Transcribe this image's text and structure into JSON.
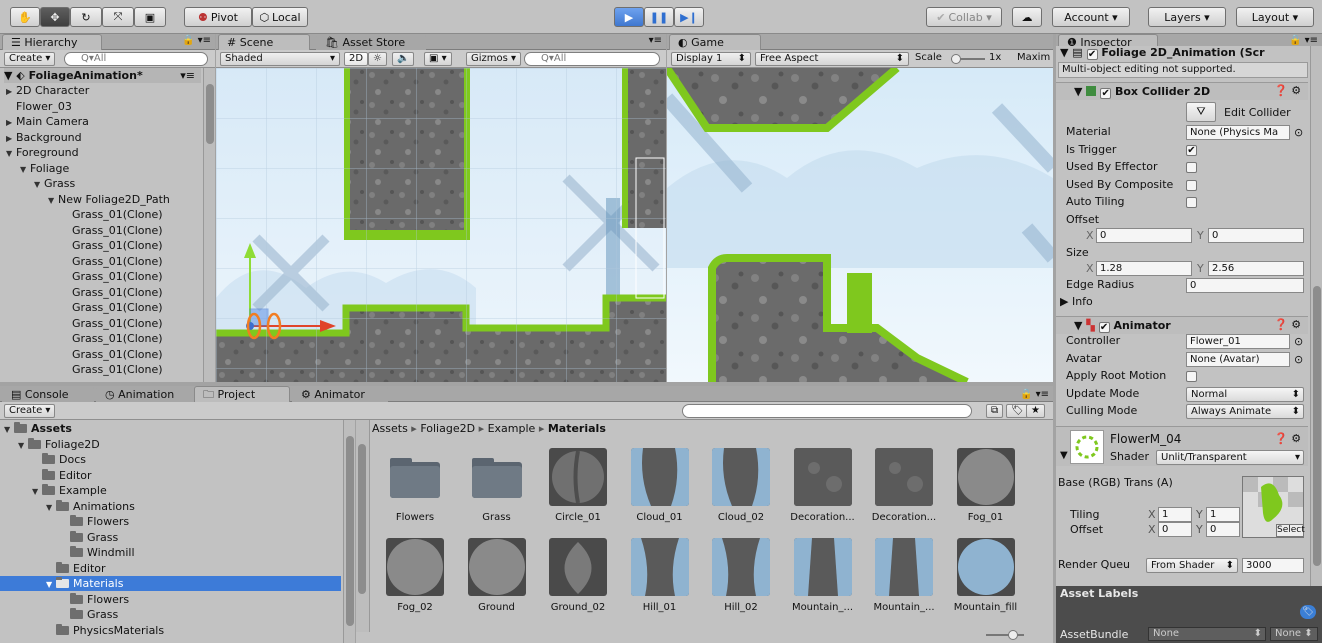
{
  "toolbar": {
    "tools": [
      "hand-icon",
      "move-icon",
      "rotate-icon",
      "scale-icon",
      "rect-icon"
    ],
    "pivot": "Pivot",
    "local": "Local",
    "collab": "Collab ▾",
    "account": "Account",
    "layers": "Layers",
    "layout": "Layout"
  },
  "hierarchy": {
    "tab": "Hierarchy",
    "create": "Create ▾",
    "search_placeholder": "Q▾All",
    "scene": "FoliageAnimation*",
    "items": [
      {
        "label": "2D Character",
        "indent": 1,
        "arrow": "▶"
      },
      {
        "label": "Flower_03",
        "indent": 1,
        "arrow": ""
      },
      {
        "label": "Main Camera",
        "indent": 1,
        "arrow": "▶"
      },
      {
        "label": "Background",
        "indent": 1,
        "arrow": "▶"
      },
      {
        "label": "Foreground",
        "indent": 1,
        "arrow": "▼"
      },
      {
        "label": "Foliage",
        "indent": 2,
        "arrow": "▼"
      },
      {
        "label": "Grass",
        "indent": 3,
        "arrow": "▼"
      },
      {
        "label": "New Foliage2D_Path",
        "indent": 4,
        "arrow": "▼"
      },
      {
        "label": "Grass_01(Clone)",
        "indent": 5,
        "arrow": ""
      },
      {
        "label": "Grass_01(Clone)",
        "indent": 5,
        "arrow": ""
      },
      {
        "label": "Grass_01(Clone)",
        "indent": 5,
        "arrow": ""
      },
      {
        "label": "Grass_01(Clone)",
        "indent": 5,
        "arrow": ""
      },
      {
        "label": "Grass_01(Clone)",
        "indent": 5,
        "arrow": ""
      },
      {
        "label": "Grass_01(Clone)",
        "indent": 5,
        "arrow": ""
      },
      {
        "label": "Grass_01(Clone)",
        "indent": 5,
        "arrow": ""
      },
      {
        "label": "Grass_01(Clone)",
        "indent": 5,
        "arrow": ""
      },
      {
        "label": "Grass_01(Clone)",
        "indent": 5,
        "arrow": ""
      },
      {
        "label": "Grass_01(Clone)",
        "indent": 5,
        "arrow": ""
      },
      {
        "label": "Grass_01(Clone)",
        "indent": 5,
        "arrow": ""
      }
    ]
  },
  "scene": {
    "tab_scene": "Scene",
    "tab_asset_store": "Asset Store",
    "shaded": "Shaded",
    "mode_2d": "2D",
    "gizmos": "Gizmos ▾",
    "search_placeholder": "Q▾All"
  },
  "game": {
    "tab": "Game",
    "display": "Display 1",
    "aspect": "Free Aspect",
    "scale_label": "Scale",
    "scale_value": "1x",
    "maximize": "Maxim"
  },
  "inspector": {
    "tab": "Inspector",
    "top_component": "Foliage 2D_Animation (Scr",
    "multi_edit": "Multi-object editing not supported.",
    "box_collider": {
      "title": "Box Collider 2D",
      "edit_collider": "Edit Collider",
      "rows": [
        {
          "label": "Material",
          "value": "None (Physics Ma"
        },
        {
          "label": "Is Trigger",
          "check": "✔"
        },
        {
          "label": "Used By Effector",
          "check": ""
        },
        {
          "label": "Used By Composite",
          "check": ""
        },
        {
          "label": "Auto Tiling",
          "check": ""
        }
      ],
      "offset_label": "Offset",
      "offset_x": "0",
      "offset_y": "0",
      "size_label": "Size",
      "size_x": "1.28",
      "size_y": "2.56",
      "edge_radius_label": "Edge Radius",
      "edge_radius": "0",
      "info": "Info"
    },
    "animator": {
      "title": "Animator",
      "rows": [
        {
          "label": "Controller",
          "value": "Flower_01"
        },
        {
          "label": "Avatar",
          "value": "None (Avatar)"
        },
        {
          "label": "Apply Root Motion",
          "value": ""
        },
        {
          "label": "Update Mode",
          "value": "Normal"
        },
        {
          "label": "Culling Mode",
          "value": "Always Animate"
        }
      ]
    },
    "material": {
      "name": "FlowerM_04",
      "shader_label": "Shader",
      "shader": "Unlit/Transparent",
      "base_label": "Base (RGB) Trans (A)",
      "tiling_label": "Tiling",
      "offset_label": "Offset",
      "tiling_x": "1",
      "tiling_y": "1",
      "offset_x": "0",
      "offset_y": "0",
      "select": "Select",
      "render_queue_label": "Render Queu",
      "render_queue_mode": "From Shader",
      "render_queue_value": "3000"
    },
    "asset_labels": "Asset Labels",
    "asset_bundle_label": "AssetBundle",
    "asset_bundle_value": "None",
    "asset_bundle_variant": "None"
  },
  "bottom_tabs": {
    "console": "Console",
    "animation": "Animation",
    "project": "Project",
    "animator": "Animator"
  },
  "project": {
    "create": "Create ▾",
    "breadcrumb": [
      "Assets",
      "Foliage2D",
      "Example",
      "Materials"
    ],
    "tree": [
      {
        "label": "Assets",
        "indent": 0,
        "arrow": "▼",
        "bold": true
      },
      {
        "label": "Foliage2D",
        "indent": 1,
        "arrow": "▼"
      },
      {
        "label": "Docs",
        "indent": 2,
        "arrow": ""
      },
      {
        "label": "Editor",
        "indent": 2,
        "arrow": ""
      },
      {
        "label": "Example",
        "indent": 2,
        "arrow": "▼"
      },
      {
        "label": "Animations",
        "indent": 3,
        "arrow": "▼"
      },
      {
        "label": "Flowers",
        "indent": 4,
        "arrow": ""
      },
      {
        "label": "Grass",
        "indent": 4,
        "arrow": ""
      },
      {
        "label": "Windmill",
        "indent": 4,
        "arrow": ""
      },
      {
        "label": "Editor",
        "indent": 3,
        "arrow": ""
      },
      {
        "label": "Materials",
        "indent": 3,
        "arrow": "▼",
        "selected": true
      },
      {
        "label": "Flowers",
        "indent": 4,
        "arrow": ""
      },
      {
        "label": "Grass",
        "indent": 4,
        "arrow": ""
      },
      {
        "label": "PhysicsMaterials",
        "indent": 3,
        "arrow": ""
      }
    ],
    "assets": [
      {
        "label": "Flowers",
        "kind": "folder"
      },
      {
        "label": "Grass",
        "kind": "folder"
      },
      {
        "label": "Circle_01",
        "kind": "circle"
      },
      {
        "label": "Cloud_01",
        "kind": "cloud"
      },
      {
        "label": "Cloud_02",
        "kind": "cloud"
      },
      {
        "label": "Decoration...",
        "kind": "deco"
      },
      {
        "label": "Decoration...",
        "kind": "deco"
      },
      {
        "label": "Fog_01",
        "kind": "fog"
      },
      {
        "label": "Fog_02",
        "kind": "fog"
      },
      {
        "label": "Ground",
        "kind": "fog"
      },
      {
        "label": "Ground_02",
        "kind": "leaf"
      },
      {
        "label": "Hill_01",
        "kind": "hill"
      },
      {
        "label": "Hill_02",
        "kind": "hill"
      },
      {
        "label": "Mountain_...",
        "kind": "mountain"
      },
      {
        "label": "Mountain_...",
        "kind": "mountain"
      },
      {
        "label": "Mountain_fill",
        "kind": "fill"
      }
    ]
  }
}
